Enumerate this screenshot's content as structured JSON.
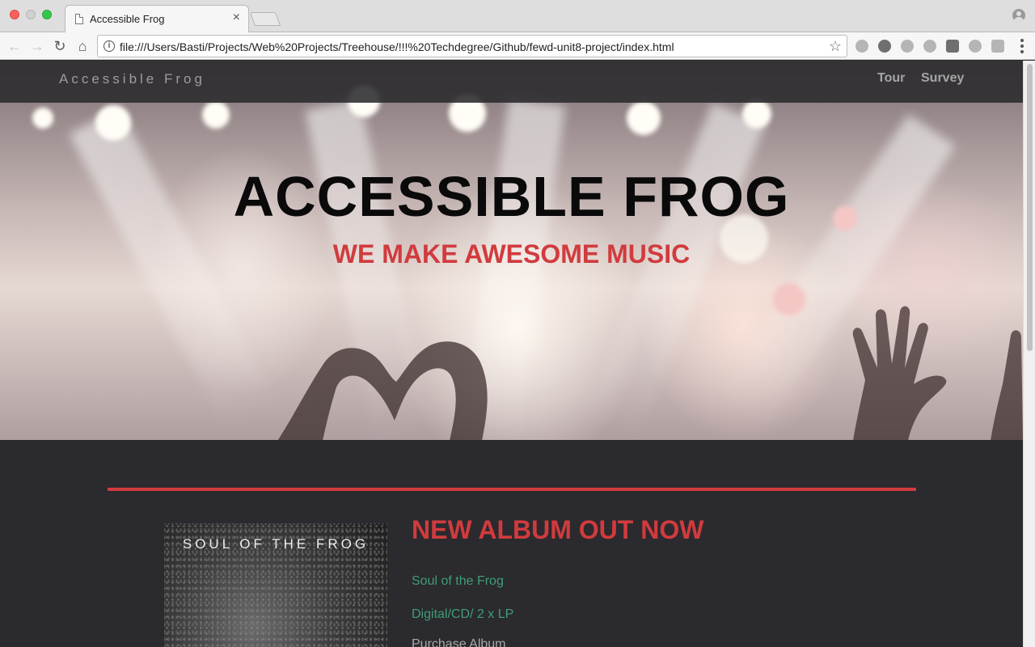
{
  "browser": {
    "tab_title": "Accessible Frog",
    "tab_close": "×",
    "url": "file:///Users/Basti/Projects/Web%20Projects/Treehouse/!!!%20Techdegree/Github/fewd-unit8-project/index.html",
    "back_glyph": "←",
    "forward_glyph": "→",
    "reload_glyph": "↻",
    "home_glyph": "⌂",
    "info_glyph": "i",
    "star_glyph": "☆"
  },
  "site": {
    "brand": "Accessible Frog",
    "nav": [
      {
        "label": "Tour"
      },
      {
        "label": "Survey"
      }
    ],
    "hero": {
      "title": "ACCESSIBLE FROG",
      "subtitle": "WE MAKE AWESOME MUSIC"
    },
    "album": {
      "cover_text": "SOUL OF THE FROG",
      "heading": "NEW ALBUM OUT NOW",
      "name": "Soul of the Frog",
      "formats": "Digital/CD/ 2 x LP",
      "purchase": "Purchase Album"
    }
  },
  "colors": {
    "accent_red": "#d13b3e",
    "page_dark": "#2b2a2e",
    "link_green": "#3f9e78"
  }
}
